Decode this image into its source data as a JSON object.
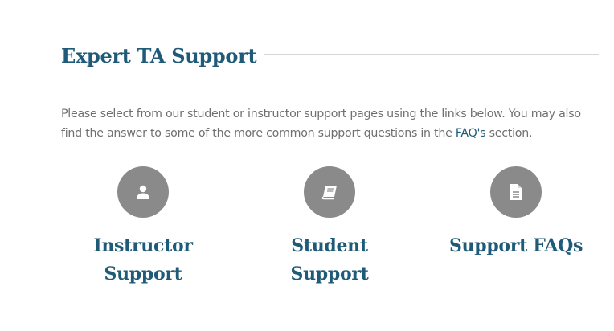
{
  "section": {
    "title": "Expert TA Support"
  },
  "intro": {
    "text_before": "Please select from our student or instructor support pages using the links below. You may also find the answer to some of the more common support questions in the ",
    "link_text": "FAQ's",
    "text_after": " section."
  },
  "cards": [
    {
      "icon": "user-icon",
      "line1": "Instructor",
      "line2": "Support"
    },
    {
      "icon": "book-icon",
      "line1": "Student",
      "line2": "Support"
    },
    {
      "icon": "document-icon",
      "line1": "Support FAQs",
      "line2": ""
    }
  ],
  "colors": {
    "heading": "#1f5b78",
    "body_text": "#6f6f6f",
    "icon_circle": "#8a8a8a",
    "rule": "#d6d6d6"
  }
}
